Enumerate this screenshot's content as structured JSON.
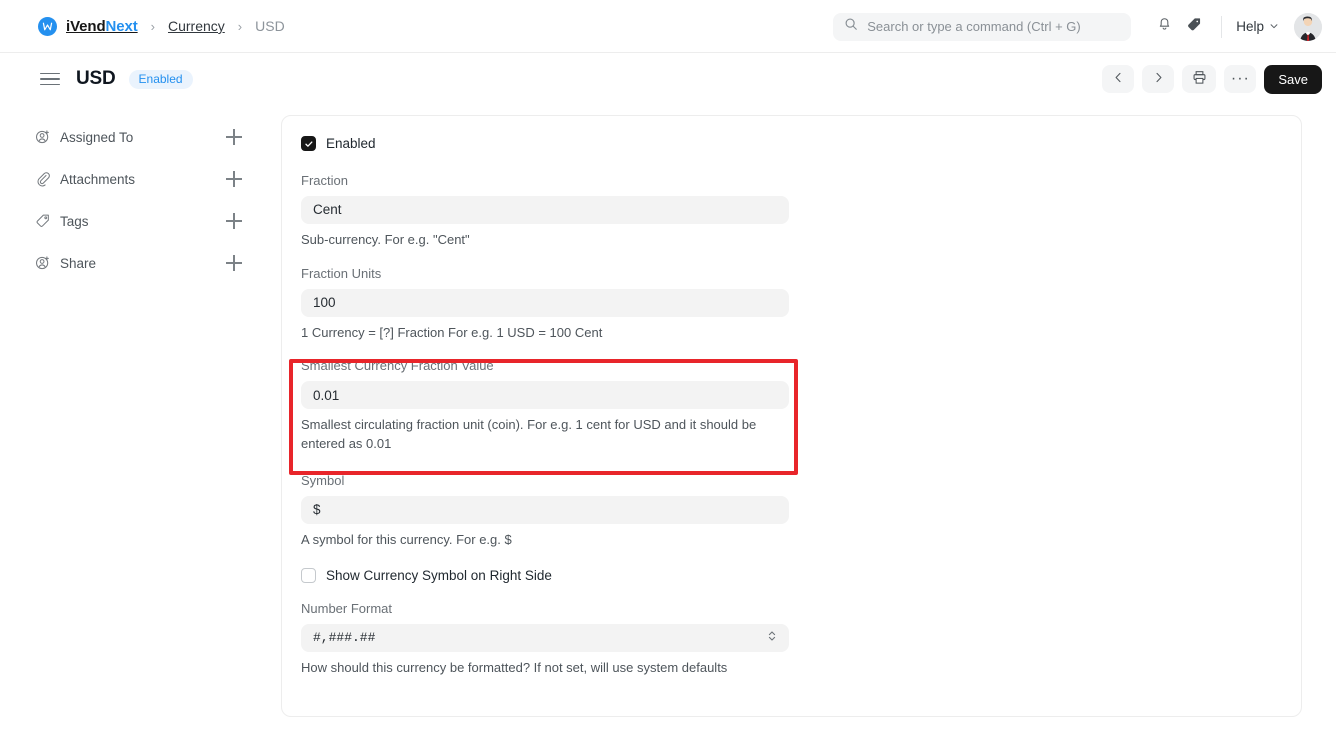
{
  "navbar": {
    "brand_first": "iVend",
    "brand_second": "Next",
    "logo_icon": "ivendnext-logo-icon",
    "breadcrumb": [
      {
        "label": "Currency",
        "muted": false
      },
      {
        "label": "USD",
        "muted": true
      }
    ],
    "separator": "›",
    "search": {
      "placeholder": "Search or type a command (Ctrl + G)",
      "value": "",
      "icon": "search-icon"
    },
    "notifications_icon": "bell-icon",
    "tag_icon": "tag-icon",
    "help_label": "Help",
    "help_chevron_icon": "chevron-down-icon",
    "avatar_icon": "user-avatar"
  },
  "page_header": {
    "menu_icon": "hamburger-icon",
    "title": "USD",
    "status_badge": "Enabled",
    "actions": {
      "prev_icon": "chevron-left-icon",
      "next_icon": "chevron-right-icon",
      "print_icon": "printer-icon",
      "more_icon": "ellipsis-icon",
      "more_label": "···",
      "save_label": "Save"
    }
  },
  "sidebar": {
    "items": [
      {
        "label": "Assigned To",
        "icon": "user-plus-icon",
        "add_icon": "plus-icon"
      },
      {
        "label": "Attachments",
        "icon": "paperclip-icon",
        "add_icon": "plus-icon"
      },
      {
        "label": "Tags",
        "icon": "tag-icon",
        "add_icon": "plus-icon"
      },
      {
        "label": "Share",
        "icon": "user-plus-icon",
        "add_icon": "plus-icon"
      }
    ]
  },
  "form": {
    "enabled": {
      "label": "Enabled",
      "checked": true
    },
    "fraction": {
      "label": "Fraction",
      "value": "Cent",
      "help": "Sub-currency. For e.g. \"Cent\""
    },
    "fraction_units": {
      "label": "Fraction Units",
      "value": "100",
      "help": "1 Currency = [?] Fraction For e.g. 1 USD = 100 Cent"
    },
    "smallest_fraction": {
      "label": "Smallest Currency Fraction Value",
      "value": "0.01",
      "help": "Smallest circulating fraction unit (coin). For e.g. 1 cent for USD and it should be entered as 0.01",
      "highlighted": true
    },
    "symbol": {
      "label": "Symbol",
      "value": "$",
      "help": "A symbol for this currency. For e.g. $"
    },
    "symbol_right": {
      "label": "Show Currency Symbol on Right Side",
      "checked": false
    },
    "number_format": {
      "label": "Number Format",
      "value": "#,###.##",
      "help": "How should this currency be formatted? If not set, will use system defaults",
      "stepper_icon": "chevron-up-down-icon"
    }
  },
  "colors": {
    "accent": "#2490ef",
    "annotation": "#e8252a",
    "save_button": "#171717",
    "input_bg": "#f3f3f3"
  }
}
